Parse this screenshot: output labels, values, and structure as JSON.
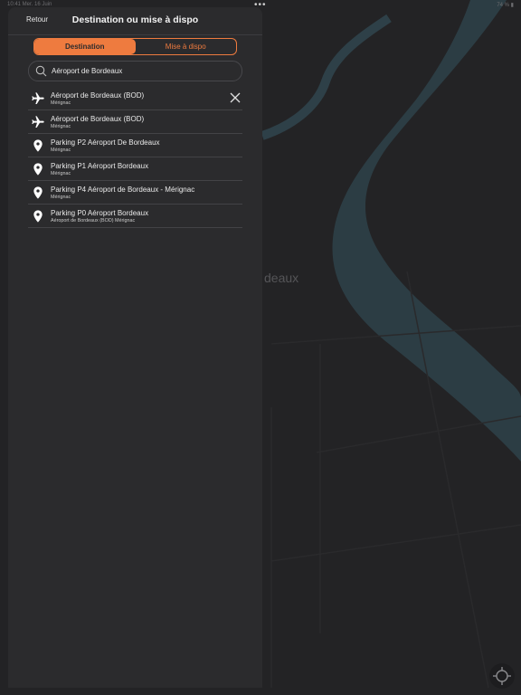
{
  "status_bar": {
    "left_text": "10:41  Mer. 16 Juin",
    "right_text": "74 % ▮"
  },
  "map": {
    "city_label": "deaux",
    "water_color": "#2e4048",
    "land_color": "#232325"
  },
  "header": {
    "back_label": "Retour",
    "title": "Destination ou mise à dispo"
  },
  "tabs": [
    {
      "label": "Destination",
      "selected": true
    },
    {
      "label": "Mise à dispo",
      "selected": false
    }
  ],
  "search": {
    "value": "Aéroport de Bordeaux",
    "icon": "search-icon"
  },
  "results": [
    {
      "icon": "airplane-icon",
      "title": "Aéroport de Bordeaux (BOD)",
      "subtitle": "Mérignac"
    },
    {
      "icon": "airplane-icon",
      "title": "Aéroport de Bordeaux (BOD)",
      "subtitle": "Mérignac"
    },
    {
      "icon": "map-pin-icon",
      "title": "Parking P2 Aéroport De Bordeaux",
      "subtitle": "Mérignac"
    },
    {
      "icon": "map-pin-icon",
      "title": "Parking P1 Aéroport Bordeaux",
      "subtitle": "Mérignac"
    },
    {
      "icon": "map-pin-icon",
      "title": "Parking P4 Aéroport de Bordeaux - Mérignac",
      "subtitle": "Mérignac"
    },
    {
      "icon": "map-pin-icon",
      "title": "Parking P0 Aéroport Bordeaux",
      "subtitle": "Aéroport de Bordeaux (BOD) Mérignac"
    }
  ],
  "colors": {
    "accent": "#ee7b3f",
    "panel": "#2b2b2d",
    "text": "#eaeaea"
  }
}
